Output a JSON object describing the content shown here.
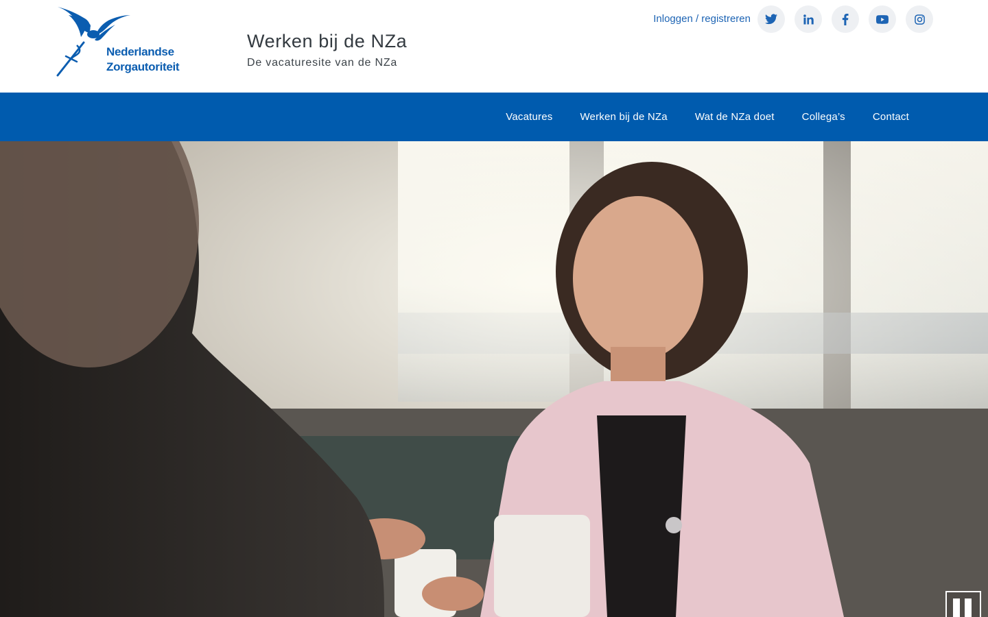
{
  "brand": {
    "logo_line1": "Nederlandse",
    "logo_line2": "Zorgautoriteit",
    "color": "#0b5db0"
  },
  "site": {
    "title": "Werken bij de NZa",
    "subtitle": "De vacaturesite van de NZa"
  },
  "header": {
    "login_label": "Inloggen / registreren",
    "socials": [
      {
        "icon": "twitter-icon"
      },
      {
        "icon": "linkedin-icon"
      },
      {
        "icon": "facebook-icon"
      },
      {
        "icon": "youtube-icon"
      },
      {
        "icon": "instagram-icon"
      }
    ]
  },
  "nav": {
    "background": "#005bae",
    "items": [
      {
        "label": "Vacatures"
      },
      {
        "label": "Werken bij de NZa"
      },
      {
        "label": "Wat de NZa doet"
      },
      {
        "label": "Collega’s"
      },
      {
        "label": "Contact"
      }
    ]
  },
  "hero": {
    "video_control_icon": "pause-icon"
  }
}
